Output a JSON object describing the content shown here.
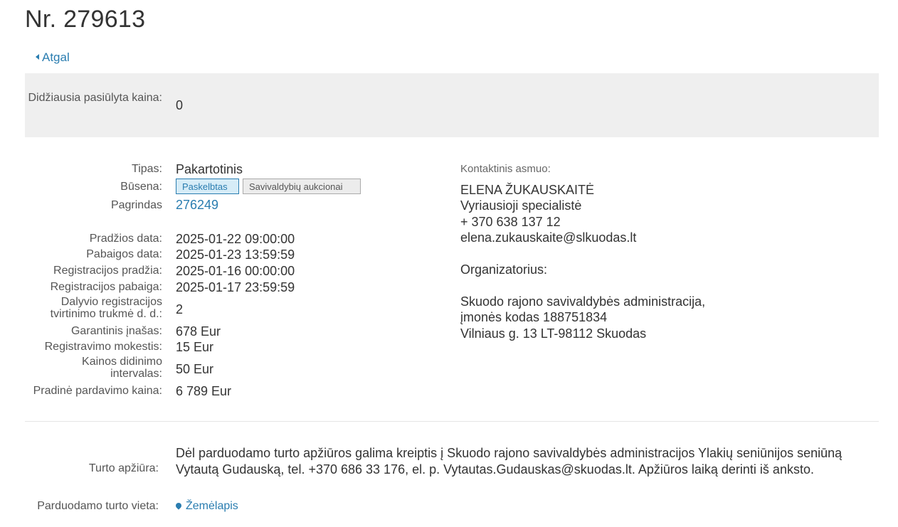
{
  "page": {
    "title": "Nr. 279613",
    "back_label": "Atgal"
  },
  "highest_price": {
    "label": "Didžiausia pasiūlyta kaina:",
    "value": "0"
  },
  "details": {
    "type": {
      "label": "Tipas:",
      "value": "Pakartotinis"
    },
    "status": {
      "label": "Būsena:",
      "badges": [
        "Paskelbtas",
        "Savivaldybių aukcionai"
      ]
    },
    "basis": {
      "label": "Pagrindas",
      "value": "276249"
    },
    "start_date": {
      "label": "Pradžios data:",
      "value": "2025-01-22 09:00:00"
    },
    "end_date": {
      "label": "Pabaigos data:",
      "value": "2025-01-23 13:59:59"
    },
    "reg_start": {
      "label": "Registracijos pradžia:",
      "value": "2025-01-16 00:00:00"
    },
    "reg_end": {
      "label": "Registracijos pabaiga:",
      "value": "2025-01-17 23:59:59"
    },
    "confirm_duration": {
      "label_line1": "Dalyvio registracijos",
      "label_line2": "tvirtinimo trukmė d. d.:",
      "value": "2"
    },
    "deposit": {
      "label": "Garantinis įnašas:",
      "value": "678 Eur"
    },
    "reg_fee": {
      "label": "Registravimo mokestis:",
      "value": "15 Eur"
    },
    "bid_step": {
      "label_line1": "Kainos didinimo",
      "label_line2": "intervalas:",
      "value": "50 Eur"
    },
    "initial_price": {
      "label": "Pradinė pardavimo kaina:",
      "value": "6 789 Eur"
    }
  },
  "contact": {
    "heading": "Kontaktinis asmuo:",
    "name": "ELENA ŽUKAUSKAITĖ",
    "position": "Vyriausioji specialistė",
    "phone": "+ 370 638 137 12",
    "email": "elena.zukauskaite@slkuodas.lt",
    "organizer_label": "Organizatorius:",
    "org_name": "Skuodo rajono savivaldybės administracija,",
    "org_code": "įmonės kodas 188751834",
    "org_address": "Vilniaus g. 13 LT-98112 Skuodas"
  },
  "inspection": {
    "label": "Turto apžiūra:",
    "text": "Dėl parduodamo turto apžiūros galima kreiptis į Skuodo rajono savivaldybės administracijos Ylakių seniūnijos seniūną Vytautą Gudauską, tel. +370 686 33 176, el. p. Vytautas.Gudauskas@skuodas.lt. Apžiūros laiką derinti iš anksto."
  },
  "location": {
    "label": "Parduodamo turto vieta:",
    "link": "Žemėlapis"
  },
  "colors": {
    "link": "#2a7db0",
    "box_bg": "#efefef",
    "badge_blue_bg": "#d6ecf7",
    "badge_gray_bg": "#ececec"
  },
  "icons": {
    "back": "caret-left-icon",
    "map": "map-marker-icon"
  }
}
